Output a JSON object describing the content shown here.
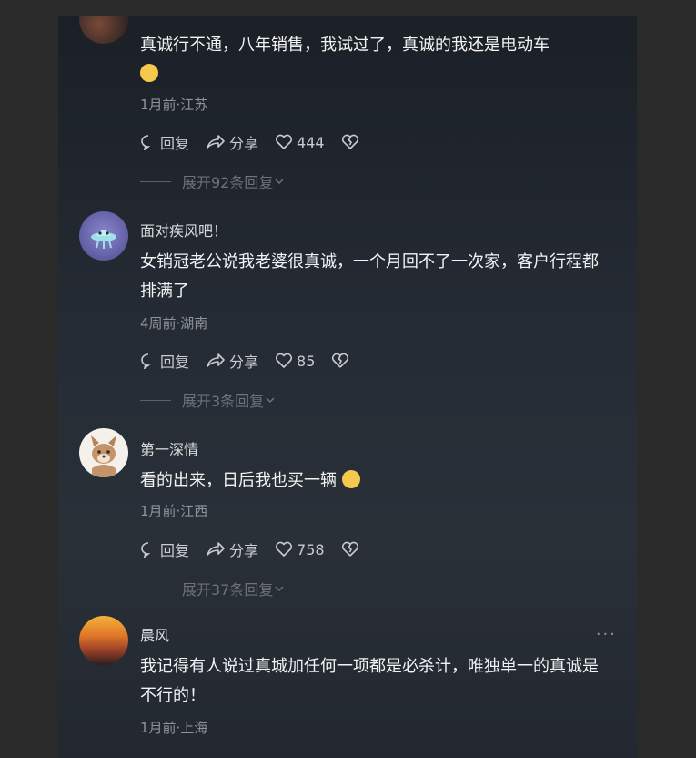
{
  "comments": [
    {
      "username": "",
      "text": "真诚行不通，八年销售，我试过了，真诚的我还是电动车",
      "meta": "1月前·江苏",
      "reply_label": "回复",
      "share_label": "分享",
      "likes": "444",
      "expand_label": "展开92条回复"
    },
    {
      "username": "面对疾风吧！",
      "text": "女销冠老公说我老婆很真诚，一个月回不了一次家，客户行程都排满了",
      "meta": "4周前·湖南",
      "reply_label": "回复",
      "share_label": "分享",
      "likes": "85",
      "expand_label": "展开3条回复"
    },
    {
      "username": "第一深情",
      "text": "看的出来，日后我也买一辆",
      "meta": "1月前·江西",
      "reply_label": "回复",
      "share_label": "分享",
      "likes": "758",
      "expand_label": "展开37条回复"
    },
    {
      "username": "晨风",
      "text": "我记得有人说过真城加任何一项都是必杀计，唯独单一的真诚是不行的！",
      "meta": "1月前·上海",
      "more": "···"
    }
  ]
}
